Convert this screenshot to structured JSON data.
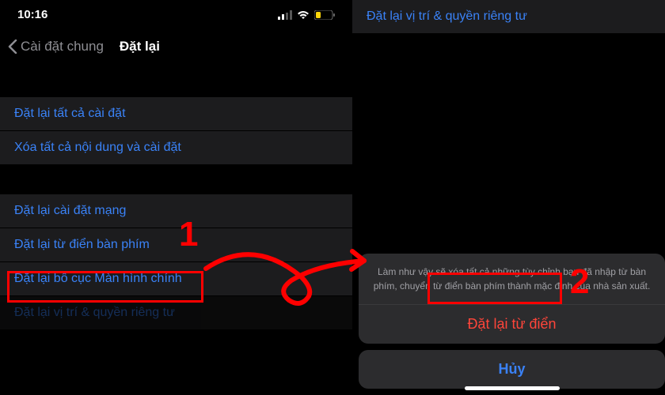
{
  "status": {
    "time": "10:16"
  },
  "nav": {
    "back_label": "Cài đặt chung",
    "title": "Đặt lại"
  },
  "left": {
    "group1": {
      "item1": "Đặt lại tất cả cài đặt",
      "item2": "Xóa tất cả nội dung và cài đặt"
    },
    "group2": {
      "item1": "Đặt lại cài đặt mạng",
      "item2": "Đặt lại từ điển bàn phím",
      "item3": "Đặt lại bố cục Màn hình chính",
      "item4": "Đặt lại vị trí & quyền riêng tư"
    }
  },
  "right": {
    "top_item": "Đặt lại vị trí & quyền riêng tư",
    "sheet": {
      "message": "Làm như vậy sẽ xóa tất cả những tùy chỉnh bạn đã nhập từ bàn phím, chuyển từ điển bàn phím thành mặc định của nhà sản xuất.",
      "confirm": "Đặt lại từ điển",
      "cancel": "Hủy"
    }
  },
  "annotations": {
    "num1": "1",
    "num2": "2"
  }
}
